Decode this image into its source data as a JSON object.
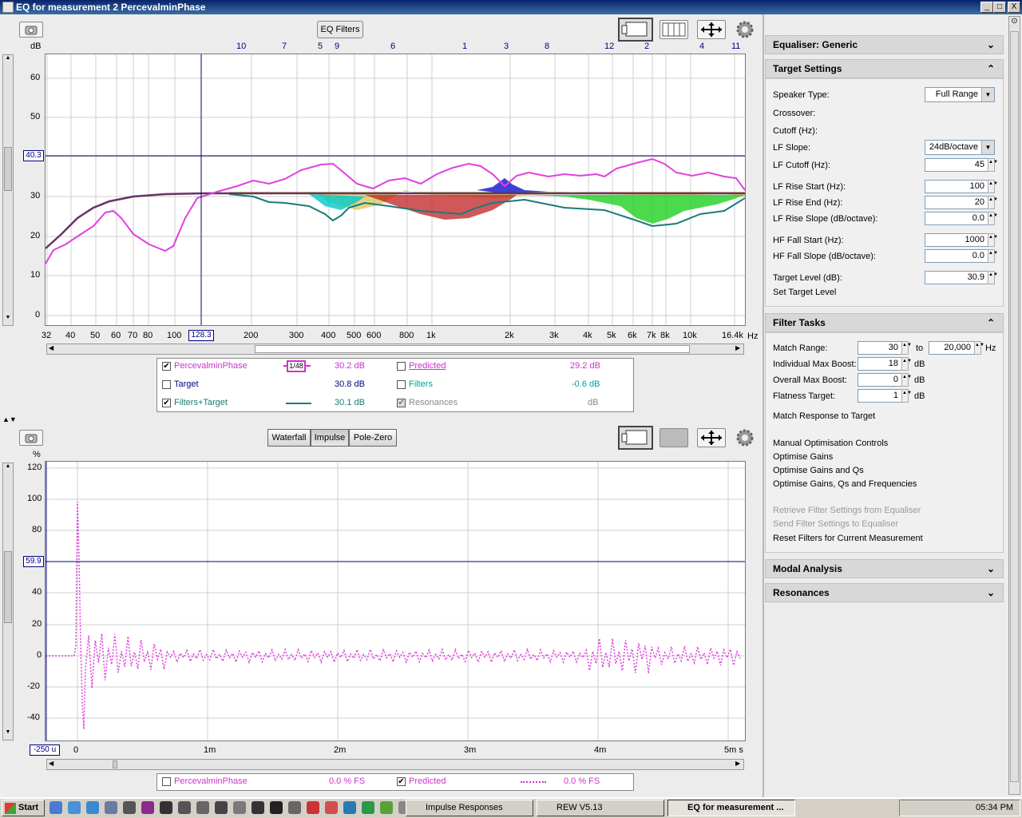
{
  "window": {
    "title": "EQ for measurement 2 PercevalminPhase",
    "min": "_",
    "max": "□",
    "close": "X"
  },
  "top": {
    "eq_filters": "EQ Filters",
    "db_unit": "dB",
    "hz_unit": "Hz",
    "cursor_x": "128.3",
    "cursor_y": "40.3",
    "y_ticks": [
      "60",
      "50",
      "40",
      "30",
      "20",
      "10",
      "0"
    ],
    "x_ticks": [
      "32",
      "40",
      "50",
      "60",
      "70",
      "80",
      "100",
      "200",
      "300",
      "400",
      "500",
      "600",
      "800",
      "1k",
      "2k",
      "3k",
      "4k",
      "5k",
      "6k",
      "7k",
      "8k",
      "10k",
      "16.4k"
    ],
    "filter_numbers": [
      "10",
      "7",
      "5",
      "9",
      "6",
      "1",
      "3",
      "8",
      "12",
      "2",
      "4",
      "11"
    ]
  },
  "legend_top": {
    "rows": [
      {
        "name": "PercevalminPhase",
        "checked": true,
        "smoothing": "1/48",
        "value": "30.2 dB",
        "color": "#cc33cc"
      },
      {
        "name": "Target",
        "checked": false,
        "value": "30.8 dB",
        "color": "#000080"
      },
      {
        "name": "Filters+Target",
        "checked": true,
        "value": "30.1 dB",
        "color": "#1a7a7a"
      },
      {
        "name": "Predicted",
        "checked": false,
        "value": "29.2 dB",
        "color": "#cc33cc"
      },
      {
        "name": "Filters",
        "checked": false,
        "value": "-0.6 dB",
        "color": "#00a0a0"
      },
      {
        "name": "Resonances",
        "checked": true,
        "value": "dB",
        "color": "#888888"
      }
    ]
  },
  "bottom": {
    "tabs": [
      "Waterfall",
      "Impulse",
      "Pole-Zero"
    ],
    "active_tab": "Impulse",
    "pct_unit": "%",
    "cursor_y": "59.9",
    "cursor_x": "-250 u",
    "y_ticks": [
      "120",
      "100",
      "80",
      "60",
      "40",
      "20",
      "0",
      "-20",
      "-40"
    ],
    "x_ticks": [
      "0",
      "1m",
      "2m",
      "3m",
      "4m",
      "5m s"
    ]
  },
  "legend_bottom": {
    "rows": [
      {
        "name": "PercevalminPhase",
        "checked": false,
        "value": "0.0 % FS",
        "color": "#cc33cc"
      },
      {
        "name": "Predicted",
        "checked": true,
        "value": "0.0 % FS",
        "color": "#cc33cc"
      }
    ]
  },
  "side": {
    "equaliser": "Equaliser: Generic",
    "target_settings": "Target Settings",
    "speaker_type_label": "Speaker Type:",
    "speaker_type": "Full Range",
    "crossover_label": "Crossover:",
    "cutoff_label": "Cutoff (Hz):",
    "lf_slope_label": "LF Slope:",
    "lf_slope": "24dB/octave",
    "lf_cutoff_label": "LF Cutoff (Hz):",
    "lf_cutoff": "45",
    "lf_rise_start_label": "LF Rise Start (Hz):",
    "lf_rise_start": "100",
    "lf_rise_end_label": "LF Rise End (Hz):",
    "lf_rise_end": "20",
    "lf_rise_slope_label": "LF Rise Slope (dB/octave):",
    "lf_rise_slope": "0.0",
    "hf_fall_start_label": "HF Fall Start (Hz):",
    "hf_fall_start": "1000",
    "hf_fall_slope_label": "HF Fall Slope (dB/octave):",
    "hf_fall_slope": "0.0",
    "target_level_label": "Target Level (dB):",
    "target_level": "30.9",
    "set_target_level": "Set Target Level",
    "filter_tasks": "Filter Tasks",
    "match_range_label": "Match Range:",
    "match_from": "30",
    "to": "to",
    "match_to": "20,000",
    "hz": "Hz",
    "ind_max_boost_label": "Individual Max Boost:",
    "ind_max_boost": "18",
    "overall_max_boost_label": "Overall Max Boost:",
    "overall_max_boost": "0",
    "flatness_label": "Flatness Target:",
    "flatness": "1",
    "db": "dB",
    "match_response": "Match Response to Target",
    "manual_opt": "Manual Optimisation Controls",
    "opt_gains": "Optimise Gains",
    "opt_gains_qs": "Optimise Gains and Qs",
    "opt_all": "Optimise Gains, Qs and Frequencies",
    "retrieve": "Retrieve Filter Settings from Equaliser",
    "send": "Send Filter Settings to Equaliser",
    "reset": "Reset Filters for Current Measurement",
    "modal_analysis": "Modal Analysis",
    "resonances": "Resonances"
  },
  "taskbar": {
    "start": "Start",
    "tasks": [
      "Impulse Responses",
      "REW V5.13",
      "EQ for measurement ..."
    ],
    "clock": "05:34 PM"
  }
}
